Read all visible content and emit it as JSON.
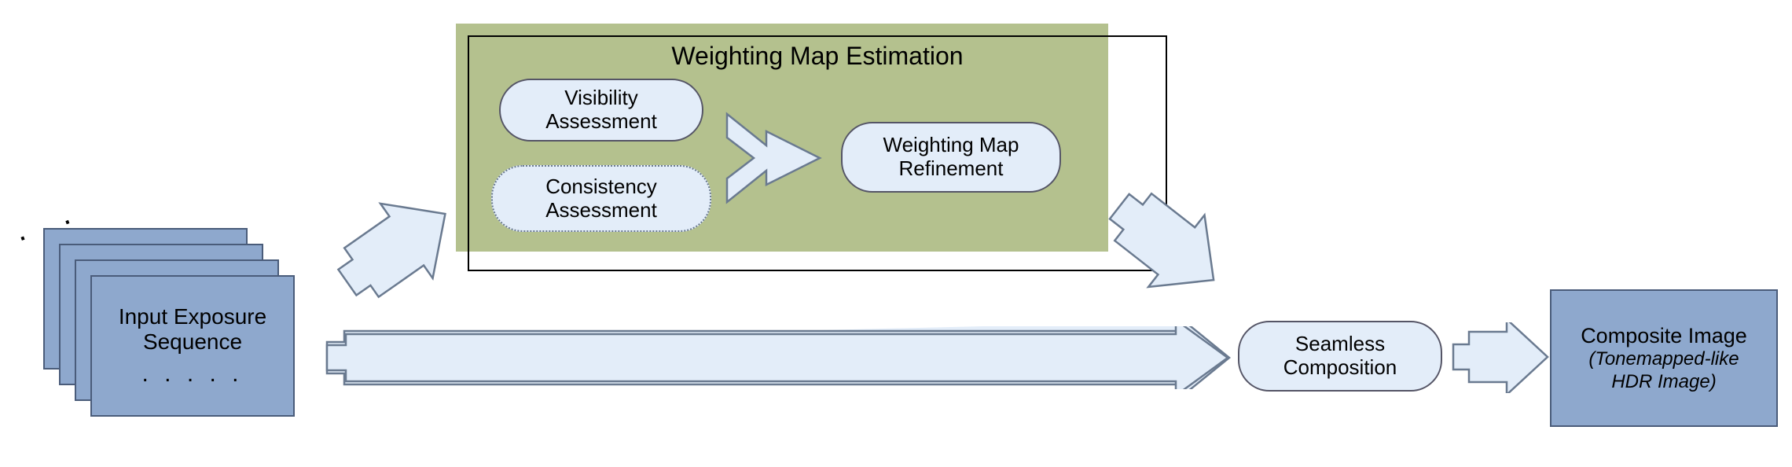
{
  "input": {
    "title_line1": "Input Exposure",
    "title_line2": "Sequence",
    "ellipsis_dots_top": ". . .",
    "ellipsis_dots_bottom": ". . . . ."
  },
  "wme": {
    "title": "Weighting Map Estimation",
    "visibility_line1": "Visibility",
    "visibility_line2": "Assessment",
    "consistency_line1": "Consistency",
    "consistency_line2": "Assessment",
    "refinement_line1": "Weighting Map",
    "refinement_line2": "Refinement"
  },
  "seamless": {
    "line1": "Seamless",
    "line2": "Composition"
  },
  "output": {
    "line1": "Composite Image",
    "line2": "(",
    "line2b": "Tonemapped-like",
    "line3": "HDR Image",
    "line3b": ")"
  },
  "colors": {
    "card_fill": "#8ea8cd",
    "card_stroke": "#4a5c7a",
    "green": "#b4c18e",
    "pill_fill": "#e3edf9",
    "arrow_fill": "#e3edf9",
    "arrow_stroke": "#6a7a90"
  }
}
